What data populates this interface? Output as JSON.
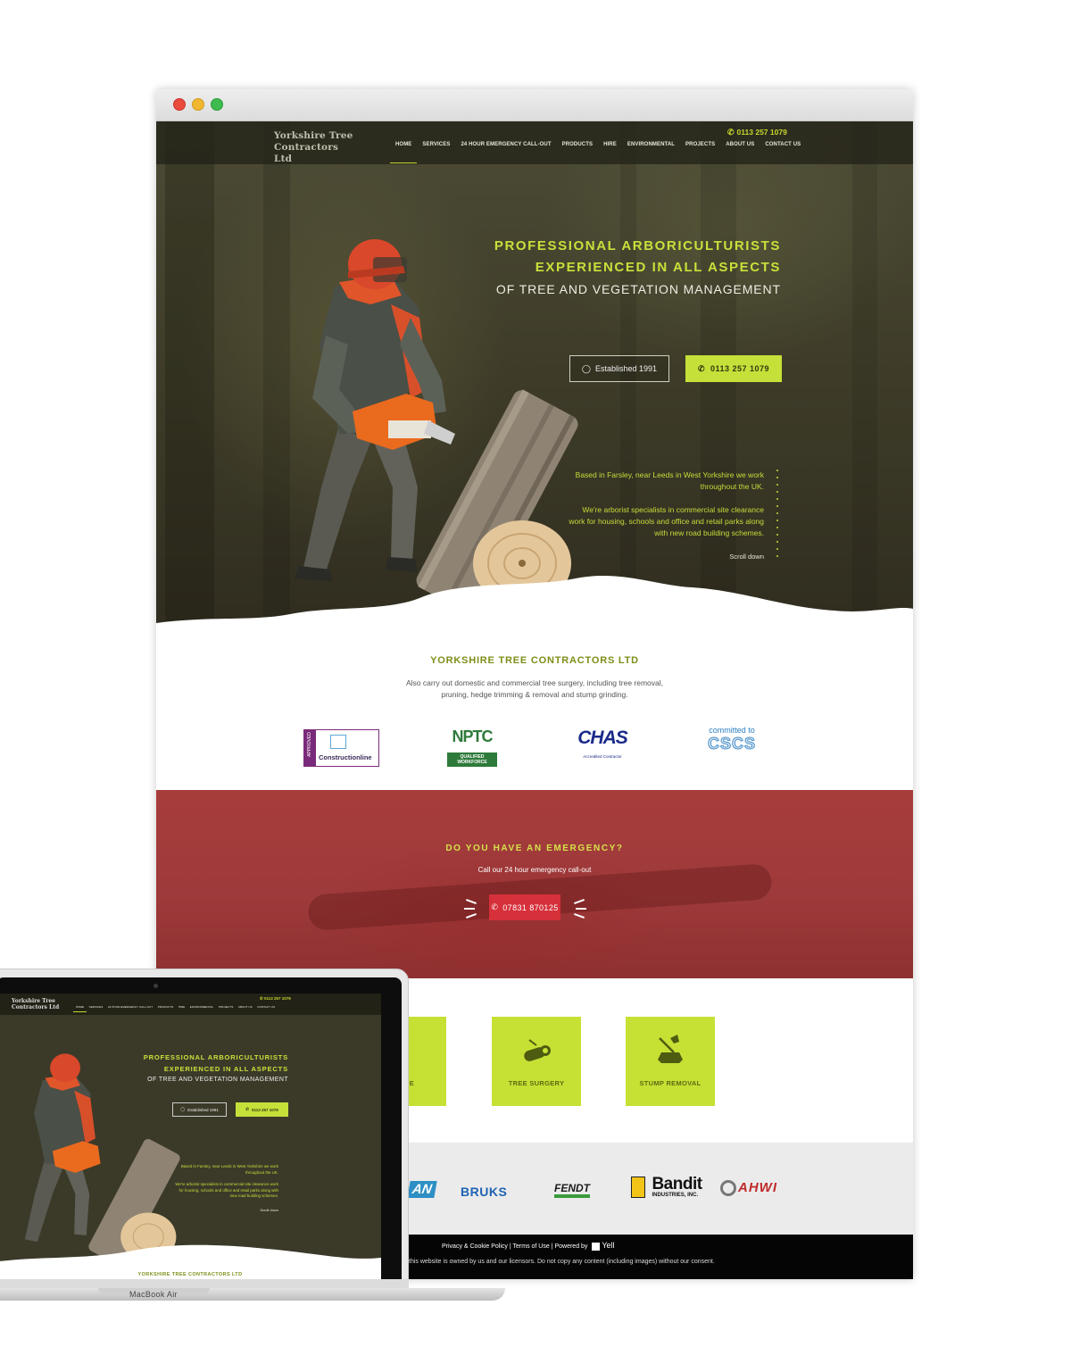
{
  "nav": {
    "logo": "Yorkshire Tree Contractors Ltd",
    "phone": "0113 257 1079",
    "items": [
      "HOME",
      "SERVICES",
      "24 HOUR EMERGENCY CALL-OUT",
      "PRODUCTS",
      "HIRE",
      "ENVIRONMENTAL",
      "PROJECTS",
      "ABOUT US",
      "CONTACT US"
    ],
    "active": "HOME"
  },
  "hero": {
    "line1": "PROFESSIONAL ARBORICULTURISTS",
    "line2": "EXPERIENCED IN ALL ASPECTS",
    "line3": "OF TREE AND VEGETATION MANAGEMENT",
    "established_label": "Established 1991",
    "call_label": "0113 257 1079",
    "intro1": "Based in Farsley, near Leeds in West Yorkshire we work throughout the UK.",
    "intro2": "We're arborist specialists in commercial site clearance work for housing, schools and office and retail parks along with new road building schemes.",
    "scroll": "Scroll down"
  },
  "company": {
    "title": "YORKSHIRE TREE CONTRACTORS LTD",
    "text1": "Also carry out domestic and commercial tree surgery, including tree removal,",
    "text2": "pruning, hedge trimming & removal and stump grinding."
  },
  "badges": {
    "constructionline_approved": "APPROVED",
    "constructionline": "Constructionline",
    "nptc": "NPTC",
    "nptc_sub": "QUALIFIED WORKFORCE",
    "chas": "CHAS",
    "chas_sub": "Accredited Contractor",
    "cscs_top": "committed to",
    "cscs": "CSCS"
  },
  "emergency": {
    "title": "DO YOU HAVE AN EMERGENCY?",
    "subtitle": "Call our 24 hour emergency call-out",
    "phone": "07831 870125"
  },
  "services": [
    {
      "label": "RANCE",
      "icon": "clearance-icon"
    },
    {
      "label": "TREE SURGERY",
      "icon": "log-icon"
    },
    {
      "label": "STUMP REMOVAL",
      "icon": "axe-stump-icon"
    }
  ],
  "brands": [
    "AN",
    "BRUKS",
    "FENDT",
    "Bandit",
    "INDUSTRIES, INC.",
    "AHWI"
  ],
  "footer": {
    "privacy": "Privacy & Cookie Policy",
    "terms": "Terms of Use",
    "powered": "Powered by",
    "yell": "Yell",
    "copy": "this website is owned by us and our licensors. Do not copy any content (including images) without our consent."
  },
  "laptop": {
    "label": "MacBook Air"
  },
  "colors": {
    "accent": "#c6e03a",
    "emergency_red": "#d6303a",
    "hero_dark": "#3f3d29"
  }
}
